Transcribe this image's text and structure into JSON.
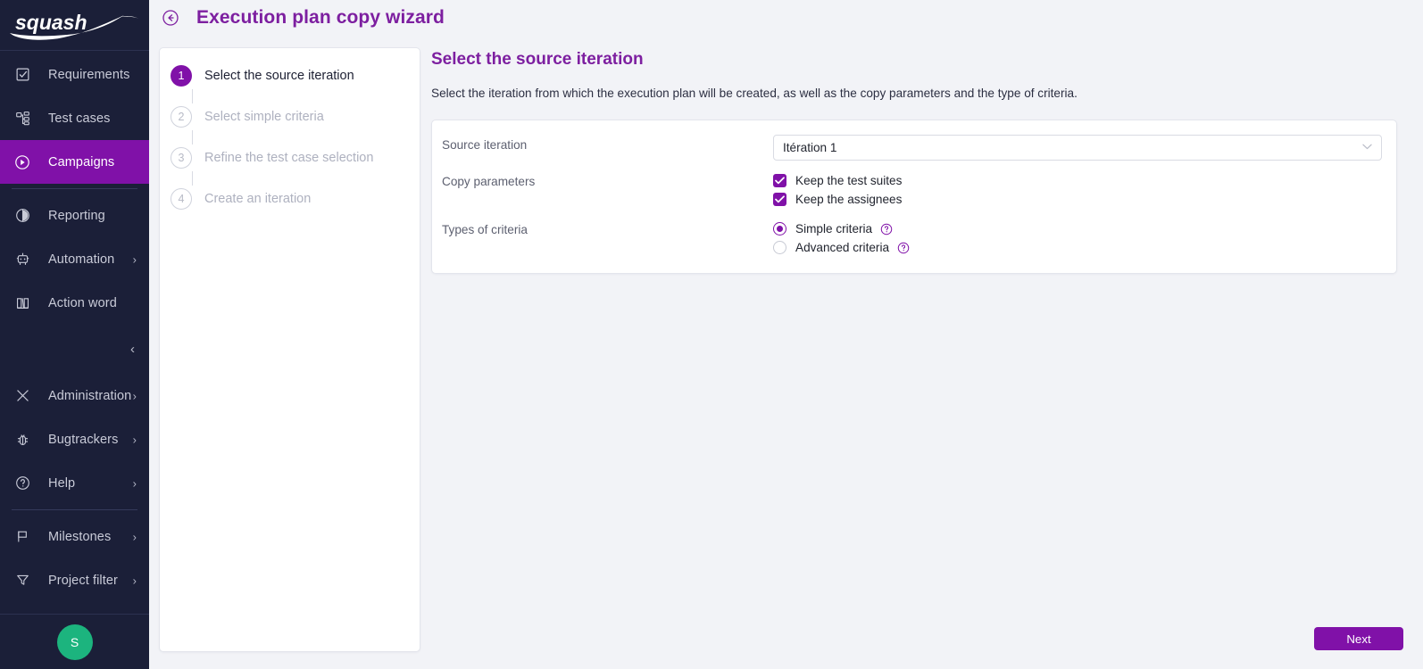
{
  "sidebar": {
    "logo_text": "squash",
    "items": [
      {
        "label": "Requirements",
        "icon": "checklist-icon",
        "has_chevron": false,
        "active": false
      },
      {
        "label": "Test cases",
        "icon": "test-case-tree-icon",
        "has_chevron": false,
        "active": false
      },
      {
        "label": "Campaigns",
        "icon": "play-circle-icon",
        "has_chevron": false,
        "active": true
      },
      {
        "label": "Reporting",
        "icon": "pie-chart-icon",
        "has_chevron": false,
        "active": false
      },
      {
        "label": "Automation",
        "icon": "robot-icon",
        "has_chevron": true,
        "active": false
      },
      {
        "label": "Action word",
        "icon": "book-icon",
        "has_chevron": false,
        "active": false
      },
      {
        "label": "Administration",
        "icon": "tools-icon",
        "has_chevron": true,
        "active": false
      },
      {
        "label": "Bugtrackers",
        "icon": "bug-icon",
        "has_chevron": true,
        "active": false
      },
      {
        "label": "Help",
        "icon": "question-circle-icon",
        "has_chevron": true,
        "active": false
      },
      {
        "label": "Milestones",
        "icon": "flag-icon",
        "has_chevron": true,
        "active": false
      },
      {
        "label": "Project filter",
        "icon": "funnel-icon",
        "has_chevron": true,
        "active": false
      }
    ],
    "collapse_icon": "chevron-left-icon",
    "avatar_initial": "S"
  },
  "header": {
    "back_icon": "arrow-left-circle-icon",
    "title": "Execution plan copy wizard"
  },
  "wizard": {
    "steps": [
      {
        "number": "1",
        "label": "Select the source iteration",
        "state": "done"
      },
      {
        "number": "2",
        "label": "Select simple criteria",
        "state": "todo"
      },
      {
        "number": "3",
        "label": "Refine the test case selection",
        "state": "todo"
      },
      {
        "number": "4",
        "label": "Create an iteration",
        "state": "todo"
      }
    ]
  },
  "content": {
    "title": "Select the source iteration",
    "subtitle": "Select the iteration from which the execution plan will be created, as well as the copy parameters and the type of criteria.",
    "fields": {
      "source_iteration_label": "Source iteration",
      "source_iteration_value": "Itération 1",
      "copy_parameters_label": "Copy parameters",
      "types_of_criteria_label": "Types of criteria"
    },
    "checkboxes": [
      {
        "label": "Keep the test suites",
        "checked": true
      },
      {
        "label": "Keep the assignees",
        "checked": true
      }
    ],
    "radios": [
      {
        "label": "Simple criteria",
        "selected": true,
        "help": "help-circle-icon"
      },
      {
        "label": "Advanced criteria",
        "selected": false,
        "help": "help-circle-icon"
      }
    ]
  },
  "footer": {
    "next_label": "Next"
  },
  "colors": {
    "accent": "#8011a8",
    "title": "#7d1fa0",
    "sidebar_bg": "#1b1f38",
    "page_bg": "#f2f3f7",
    "avatar_bg": "#1cb47e"
  }
}
